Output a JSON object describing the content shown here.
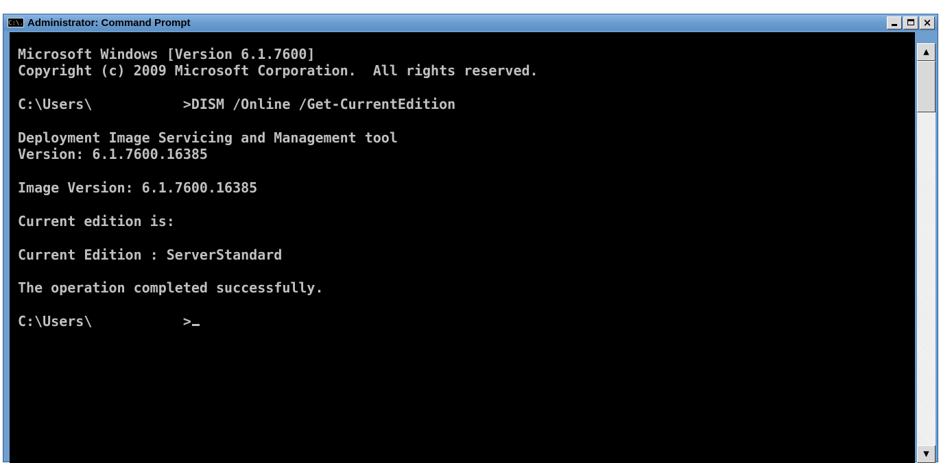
{
  "window": {
    "title": "Administrator: Command Prompt",
    "icon_text": "C:\\.",
    "close_glyph": "×"
  },
  "console": {
    "lines": [
      "Microsoft Windows [Version 6.1.7600]",
      "Copyright (c) 2009 Microsoft Corporation.  All rights reserved.",
      "",
      "C:\\Users\\           >DISM /Online /Get-CurrentEdition",
      "",
      "Deployment Image Servicing and Management tool",
      "Version: 6.1.7600.16385",
      "",
      "Image Version: 6.1.7600.16385",
      "",
      "Current edition is:",
      "",
      "Current Edition : ServerStandard",
      "",
      "The operation completed successfully.",
      "",
      "C:\\Users\\           >"
    ]
  },
  "scrollbar": {
    "up_glyph": "▲",
    "down_glyph": "▼"
  }
}
